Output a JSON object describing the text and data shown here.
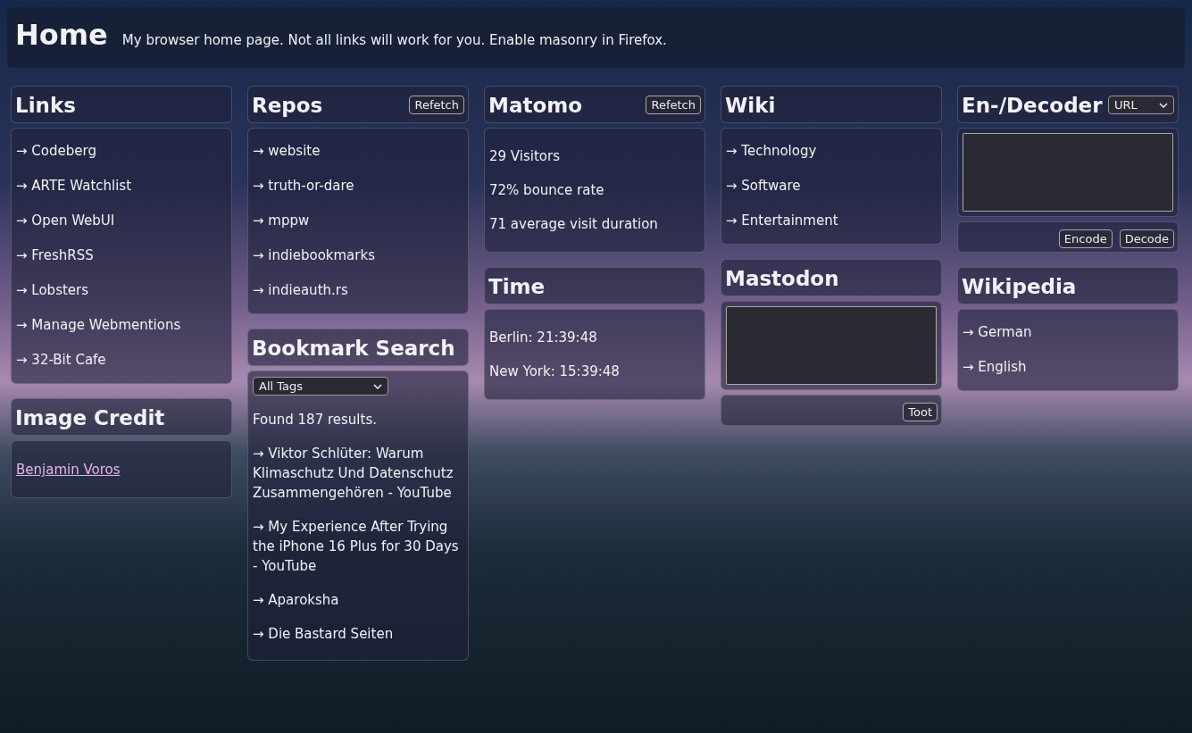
{
  "header": {
    "title": "Home",
    "subtitle": "My browser home page. Not all links will work for you. Enable masonry in Firefox."
  },
  "columns": [
    {
      "widgets": [
        {
          "kind": "links",
          "title": "Links",
          "items": [
            "→ Codeberg",
            "→ ARTE Watchlist",
            "→ Open WebUI",
            "→ FreshRSS",
            "→ Lobsters",
            "→ Manage Webmentions",
            "→ 32-Bit Cafe"
          ]
        },
        {
          "kind": "credit",
          "title": "Image Credit",
          "link": "Benjamin Voros"
        }
      ]
    },
    {
      "widgets": [
        {
          "kind": "links",
          "title": "Repos",
          "button": "Refetch",
          "items": [
            "→ website",
            "→ truth-or-dare",
            "→ mppw",
            "→ indiebookmarks",
            "→ indieauth.rs"
          ]
        },
        {
          "kind": "search",
          "title": "Bookmark Search",
          "select": "All Tags",
          "summary": "Found 187 results.",
          "items": [
            "→ Viktor Schlüter: Warum Klimaschutz Und Datenschutz Zusammengehören - YouTube",
            "→ My Experience After Trying the iPhone 16 Plus for 30 Days - YouTube",
            "→ Aparoksha",
            "→ Die Bastard Seiten"
          ]
        }
      ]
    },
    {
      "widgets": [
        {
          "kind": "stats",
          "title": "Matomo",
          "button": "Refetch",
          "lines": [
            "29 Visitors",
            "72% bounce rate",
            "71 average visit duration"
          ]
        },
        {
          "kind": "stats",
          "title": "Time",
          "lines": [
            "Berlin: 21:39:48",
            "New York: 15:39:48"
          ]
        }
      ]
    },
    {
      "widgets": [
        {
          "kind": "links",
          "title": "Wiki",
          "items": [
            "→ Technology",
            "→ Software",
            "→ Entertainment"
          ]
        },
        {
          "kind": "compose",
          "title": "Mastodon",
          "actions": [
            "Toot"
          ]
        }
      ]
    },
    {
      "widgets": [
        {
          "kind": "compose",
          "title": "En-/Decoder",
          "select": "URL",
          "actions": [
            "Encode",
            "Decode"
          ]
        },
        {
          "kind": "links",
          "title": "Wikipedia",
          "items": [
            "→ German",
            "→ English"
          ]
        }
      ]
    }
  ]
}
